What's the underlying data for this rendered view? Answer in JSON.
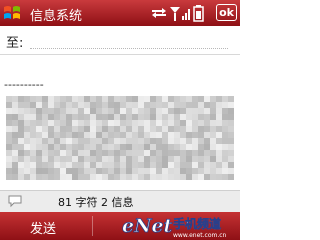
{
  "colors": {
    "titlebar": "#b01f24",
    "softbar": "#b01f24",
    "logo_stroke": "#2a3f8a"
  },
  "titlebar": {
    "title": "信息系统",
    "ok_label": "ok",
    "icons": [
      "windows-start-icon",
      "connectivity-icon",
      "signal-icon",
      "battery-icon"
    ]
  },
  "compose": {
    "to_label": "至:",
    "to_value": "",
    "signature": "----------"
  },
  "infobar": {
    "icon": "speech-bubble-icon",
    "status": "81 字符 2 信息"
  },
  "softkeys": {
    "left": "发送"
  },
  "watermark": {
    "brand": "eNet",
    "text": "手机频道",
    "url": "www.enet.com.cn"
  }
}
